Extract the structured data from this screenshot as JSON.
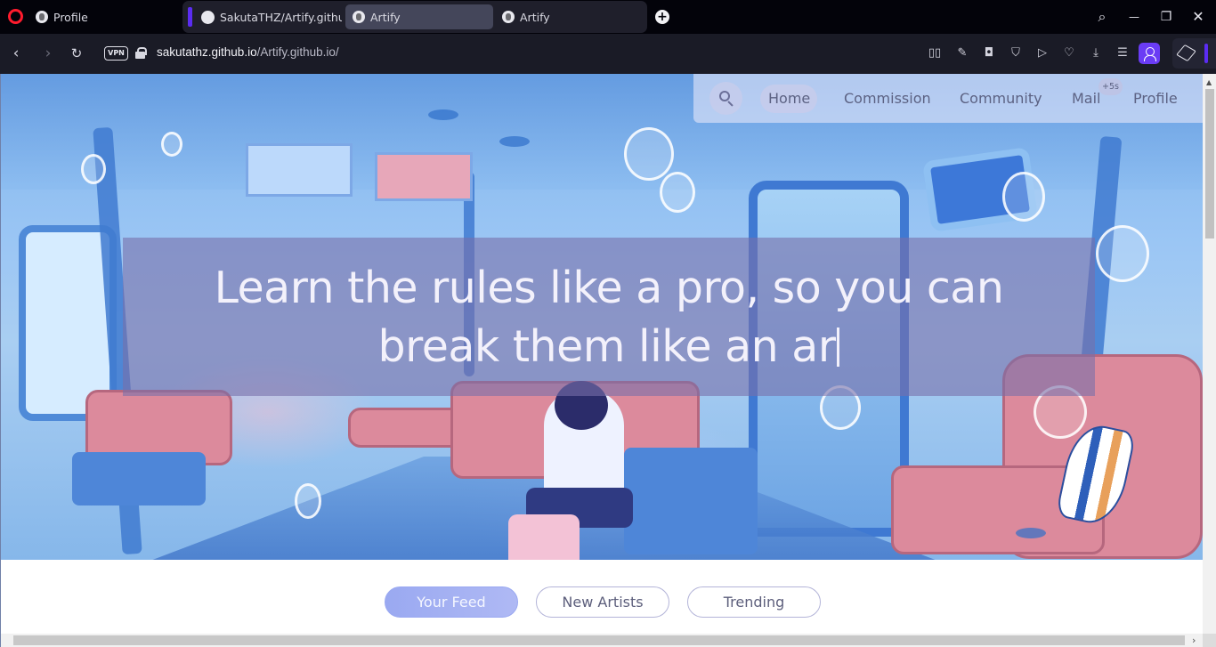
{
  "browser": {
    "tabs": [
      {
        "label": "Profile",
        "icon": "globe-icon",
        "active": false
      },
      {
        "label": "SakutaTHZ/Artify.github.io",
        "icon": "github-icon",
        "active": false
      },
      {
        "label": "Artify",
        "icon": "globe-icon",
        "active": true
      },
      {
        "label": "Artify",
        "icon": "globe-icon",
        "active": false
      }
    ],
    "new_tab": "+",
    "window_controls": {
      "search": "⌕",
      "minimize": "—",
      "maximize": "❐",
      "close": "✕"
    },
    "vpn_label": "VPN",
    "url_host": "sakutathz.github.io",
    "url_path": "/Artify.github.io/",
    "accent_color": "#5b2cf2"
  },
  "site": {
    "nav": {
      "items": [
        "Home",
        "Commission",
        "Community",
        "Mail",
        "Profile"
      ],
      "active": "Home",
      "mail_badge": "+5s"
    },
    "hero": {
      "headline_line1": "Learn the rules like a pro, so you can",
      "headline_line2": "break them like an ar"
    },
    "feed_tabs": [
      {
        "label": "Your Feed",
        "active": true
      },
      {
        "label": "New Artists",
        "active": false
      },
      {
        "label": "Trending",
        "active": false
      }
    ]
  }
}
